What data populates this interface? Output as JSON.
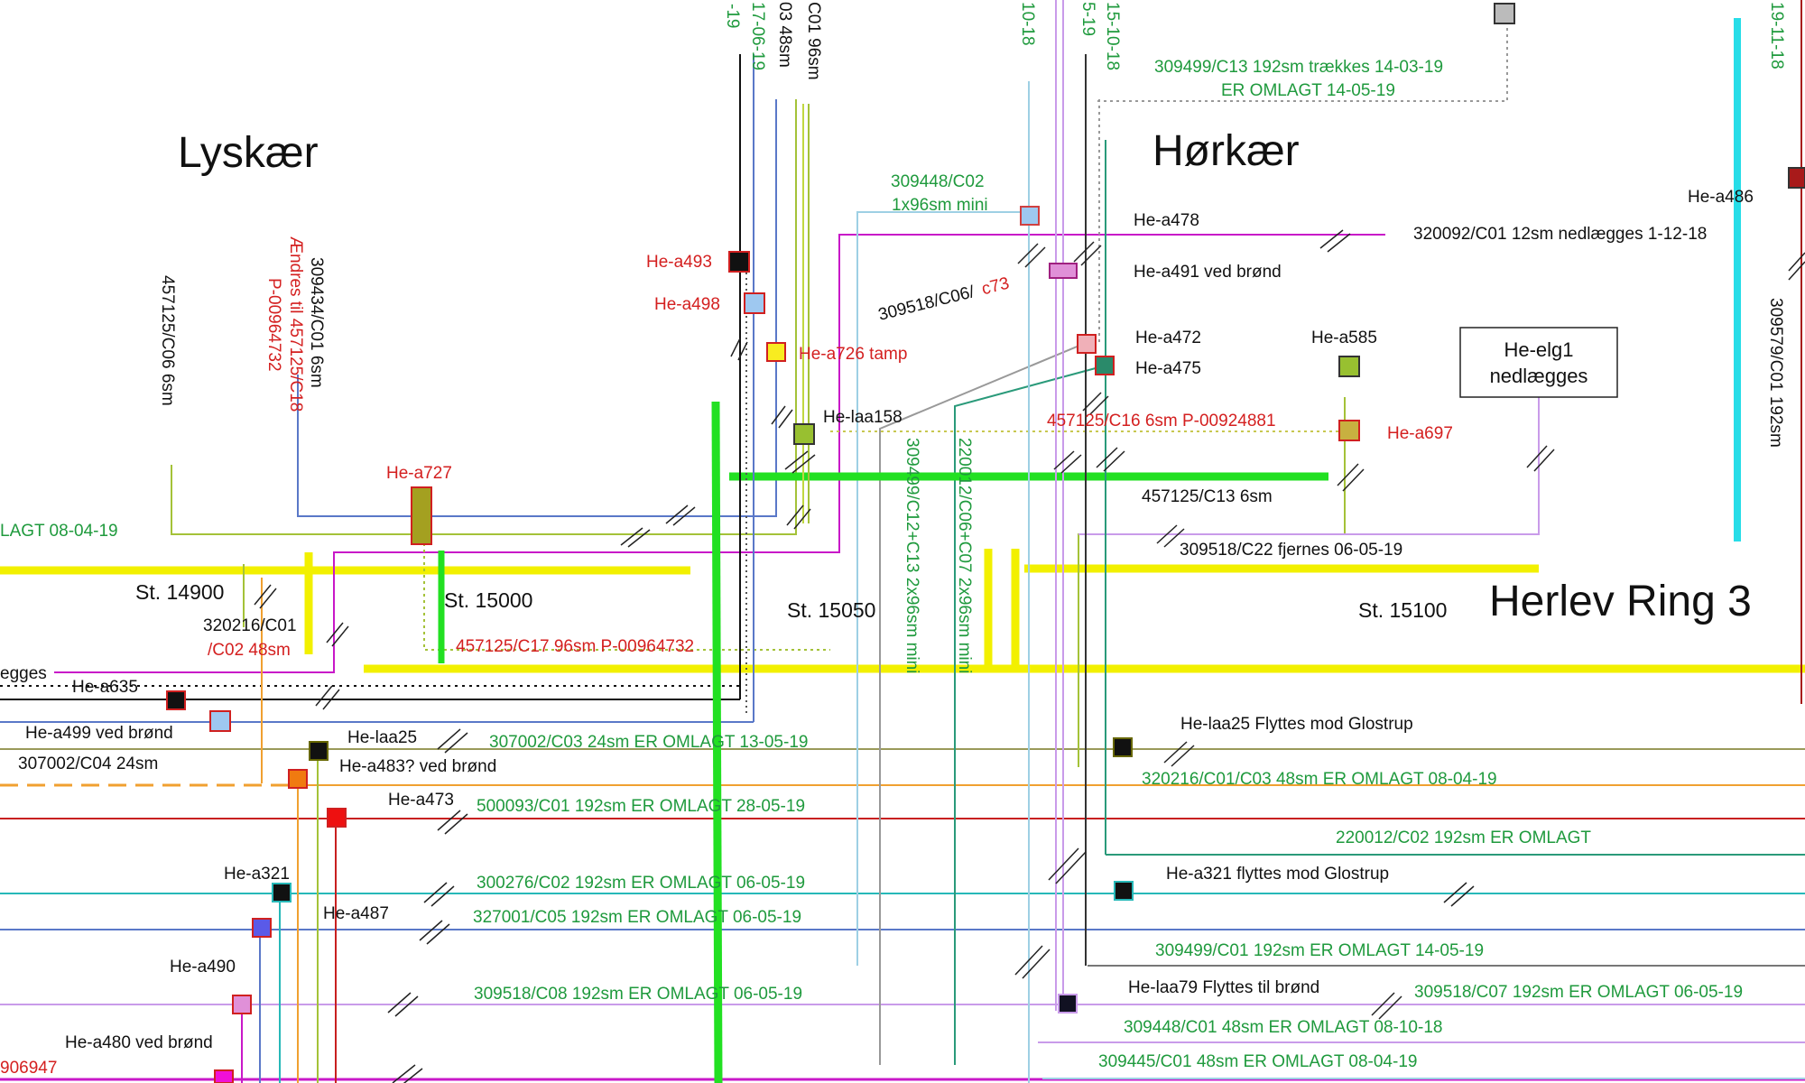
{
  "colors": {
    "road": "#f2f000",
    "green_heavy": "#22e022",
    "green_text": "#1f9a3d",
    "red_text": "#d42020",
    "cyan": "#27dde8",
    "magenta": "#c818c8",
    "violet": "#c99bea",
    "olive": "#a4c238",
    "lightblue": "#9ed0e4",
    "blue": "#5a78c8",
    "orange": "#f0a030",
    "teal": "#2a9a7a",
    "darkred": "#a81a1a",
    "gray": "#9a9a9a",
    "black": "#111111"
  },
  "areas": {
    "lyskaer": "Lyskær",
    "horkaer": "Hørkær",
    "road": "Herlev Ring 3"
  },
  "stations": {
    "s14900": "St. 14900",
    "s15000": "St. 15000",
    "s15050": "St. 15050",
    "s15100": "St. 15100"
  },
  "box_label": {
    "line1": "He-elg1",
    "line2": "nedlægges"
  },
  "vertical_labels": {
    "top_a": "-19",
    "top_b": "17-06-19",
    "top_c": "03 48sm",
    "top_d": "C01 96sm",
    "top_e": "10-18",
    "top_f": "5-19",
    "top_g": "15-10-18",
    "top_h": "19-11-18",
    "cable_457125_c06": "457125/C06 6sm",
    "cable_309434_1": "309434/C01 6sm",
    "cable_309434_2": "Ændres til 457125/C18",
    "cable_309434_3": "P-00964732",
    "cable_309499_c12": "309499/C12+C13 2x96sm mini",
    "cable_220012_c06": "220012/C06+C07 2x96sm mini",
    "cable_309579": "309579/C01 192sm"
  },
  "labels": {
    "c309499_c13_a": "309499/C13 192sm trækkes 14-03-19",
    "c309499_c13_b": "ER OMLAGT 14-05-19",
    "c309448_c02_a": "309448/C02",
    "c309448_c02_b": "1x96sm mini",
    "he_a478": "He-a478",
    "c320092": "320092/C01 12sm nedlægges 1-12-18",
    "he_a486": "He-a486",
    "he_a491": "He-a491 ved brønd",
    "c309518_c06": "309518/C06/",
    "c73": "c73",
    "he_a493": "He-a493",
    "he_a498": "He-a498",
    "he_a726": "He-a726 tamp",
    "he_a472": "He-a472",
    "he_a475": "He-a475",
    "he_a585": "He-a585",
    "he_laa158": "He-laa158",
    "c457125_c16": "457125/C16 6sm P-00924881",
    "he_a697": "He-a697",
    "he_a727": "He-a727",
    "lagt_left": "LAGT 08-04-19",
    "c457125_c13": "457125/C13 6sm",
    "c309518_c22": "309518/C22 fjernes 06-05-19",
    "c320216_a": "320216/C01",
    "c320216_b": "/C02 48sm",
    "c457125_c17": "457125/C17 96sm P-00964732",
    "egges": "egges",
    "he_a635": "He-a635",
    "he_a499": "He-a499 ved brønd",
    "he_laa25": "He-laa25",
    "c307002_c04": "307002/C04 24sm",
    "he_a483": "He-a483? ved brønd",
    "c307002_c03": "307002/C03 24sm ER OMLAGT 13-05-19",
    "he_laa25_move": "He-laa25 Flyttes mod Glostrup",
    "c320216_c01c03": "320216/C01/C03 48sm ER OMLAGT 08-04-19",
    "he_a473": "He-a473",
    "c500093": "500093/C01 192sm ER OMLAGT 28-05-19",
    "c220012_c02": "220012/C02 192sm ER OMLAGT",
    "he_a321": "He-a321",
    "he_a321_move": "He-a321 flyttes mod Glostrup",
    "c300276": "300276/C02 192sm ER OMLAGT 06-05-19",
    "he_a487": "He-a487",
    "c327001": "327001/C05 192sm ER OMLAGT 06-05-19",
    "c309499_c01": "309499/C01 192sm ER OMLAGT 14-05-19",
    "he_a490": "He-a490",
    "c309518_c08": "309518/C08 192sm ER OMLAGT 06-05-19",
    "he_laa79": "He-laa79 Flyttes til brønd",
    "c309518_c07": "309518/C07 192sm ER OMLAGT 06-05-19",
    "c309448_c01": "309448/C01 48sm ER OMLAGT 08-10-18",
    "he_a480": "He-a480 ved brønd",
    "c309445_c01": "309445/C01 48sm ER OMLAGT 08-04-19",
    "left_906947": "906947"
  }
}
